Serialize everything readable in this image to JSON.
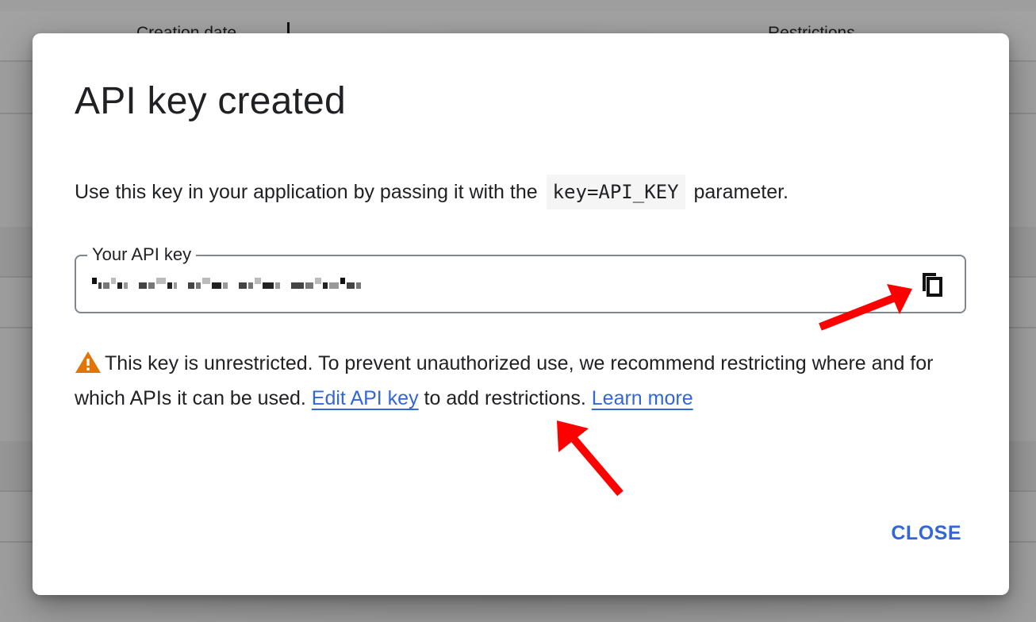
{
  "background": {
    "table_headers": [
      "Creation date",
      "Restrictions"
    ]
  },
  "dialog": {
    "title": "API key created",
    "description": {
      "before": "Use this key in your application by passing it with the",
      "code": "key=API_KEY",
      "after": "parameter."
    },
    "key_field": {
      "label": "Your API key",
      "value_redacted": true,
      "copy_icon": "copy-icon"
    },
    "warning": {
      "icon": "warning-icon",
      "text_1": "This key is unrestricted. To prevent unauthorized use, we recommend restricting where and for which APIs it can be used.",
      "edit_link": "Edit API key",
      "text_2": "to add restrictions.",
      "learn_more_link": "Learn more"
    },
    "close_label": "CLOSE"
  },
  "annotations": {
    "arrows": [
      "pointing-to-copy-icon",
      "pointing-to-edit-api-key-link"
    ],
    "arrow_color": "#ff0000"
  },
  "colors": {
    "link": "#3367d6",
    "warning": "#e37400",
    "text": "#202124"
  }
}
